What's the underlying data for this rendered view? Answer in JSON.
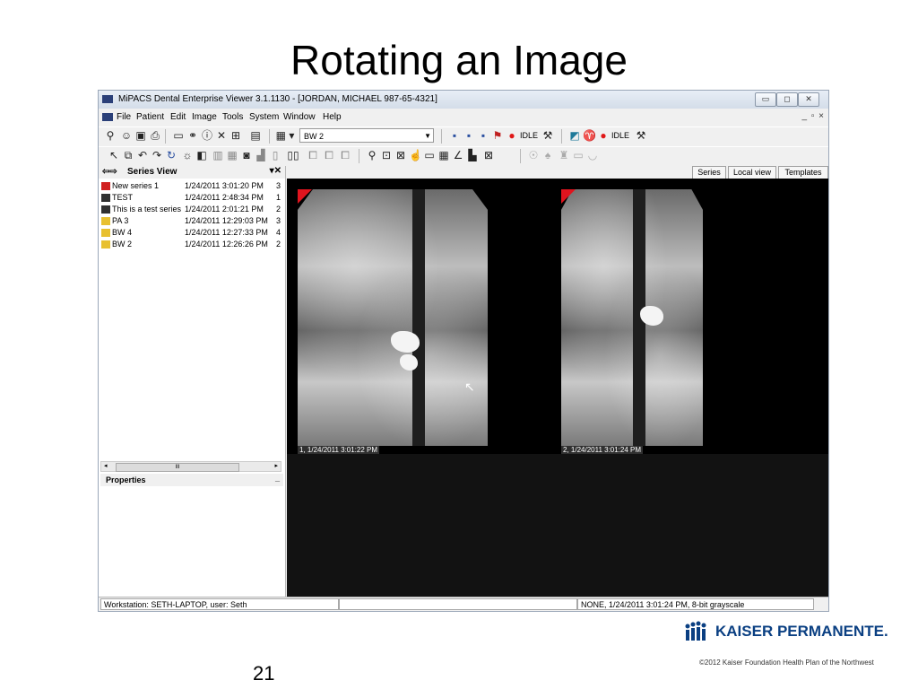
{
  "slide": {
    "title": "Rotating an Image",
    "page_number": "21",
    "copyright": "©2012 Kaiser Foundation Health Plan of the Northwest",
    "logo_text": "KAISER PERMANENTE.",
    "brand_color": "#0a3f82"
  },
  "window": {
    "title": "MiPACS Dental Enterprise Viewer 3.1.1130 - [JORDAN, MICHAEL  987-65-4321]",
    "controls": [
      "minimize",
      "maximize",
      "close"
    ]
  },
  "menu": {
    "items": [
      "File",
      "Patient",
      "Edit",
      "Image",
      "Tools",
      "System",
      "Window",
      "Help"
    ],
    "mdi_controls": "_ ▫ ×"
  },
  "toolbar": {
    "series_select": "BW 2",
    "idle_label_1": "IDLE",
    "idle_label_2": "IDLE",
    "layout_label": "▦ ▾"
  },
  "series_view": {
    "title": "Series View",
    "rows": [
      {
        "name": "New series 1",
        "date": "1/24/2011 3:01:20 PM",
        "count": "3",
        "icon": "series-new-icon"
      },
      {
        "name": "TEST",
        "date": "1/24/2011 2:48:34 PM",
        "count": "1",
        "icon": "series-icon"
      },
      {
        "name": "This is a test series",
        "date": "1/24/2011 2:01:21 PM",
        "count": "2",
        "icon": "series-icon"
      },
      {
        "name": "PA 3",
        "date": "1/24/2011 12:29:03 PM",
        "count": "3",
        "icon": "folder-icon"
      },
      {
        "name": "BW 4",
        "date": "1/24/2011 12:27:33 PM",
        "count": "4",
        "icon": "folder-icon"
      },
      {
        "name": "BW 2",
        "date": "1/24/2011 12:26:26 PM",
        "count": "2",
        "icon": "folder-icon"
      }
    ],
    "scroll_thumb": "III"
  },
  "properties": {
    "title": "Properties",
    "collapse": "_"
  },
  "tabs": [
    "Series",
    "Local view",
    "Templates"
  ],
  "images": [
    {
      "label": "1, 1/24/2011 3:01:22 PM"
    },
    {
      "label": "2, 1/24/2011 3:01:24 PM"
    }
  ],
  "status": {
    "workstation": "Workstation: SETH-LAPTOP, user: Seth",
    "image_info": "NONE, 1/24/2011 3:01:24 PM, 8-bit grayscale"
  }
}
